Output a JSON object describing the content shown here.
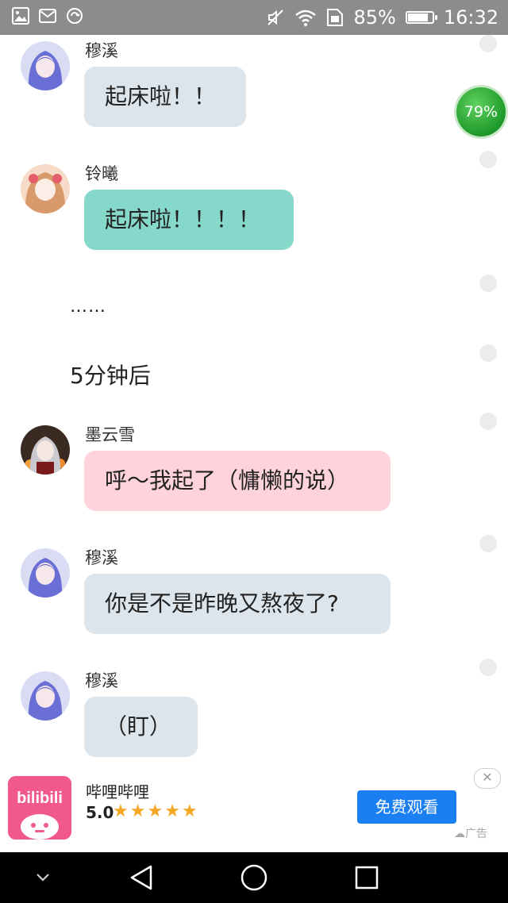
{
  "status_bar": {
    "battery_percent_text": "85%",
    "battery_level": 0.85,
    "time": "16:32",
    "left_icons": [
      "image-icon",
      "mail-icon",
      "sync-icon"
    ],
    "right_icons": [
      "mute-icon",
      "wifi-icon",
      "sim-icon",
      "battery-icon"
    ]
  },
  "floating_badge": {
    "text": "79%"
  },
  "chat": {
    "messages": [
      {
        "sender": "穆溪",
        "text": "起床啦！！",
        "bubble_color": "#dde5ec"
      },
      {
        "sender": "铃曦",
        "text": "起床啦！！！！",
        "bubble_color": "#86d8cb"
      },
      {
        "sender": "墨云雪",
        "text": "呼～我起了（慵懒的说）",
        "bubble_color": "#ffd3dc"
      },
      {
        "sender": "穆溪",
        "text": "你是不是昨晚又熬夜了?",
        "bubble_color": "#dde5ec"
      },
      {
        "sender": "穆溪",
        "text": "（盯）",
        "bubble_color": "#dde5ec"
      }
    ],
    "narration": [
      "……",
      "5分钟后"
    ]
  },
  "ad": {
    "app_name": "哔哩哔哩",
    "rating_text": "5.0",
    "rating_value": 4.5,
    "rating_max": 5,
    "button_label": "免费观看",
    "tag": "广告",
    "close_symbol": "✕",
    "logo_text": "bilibili"
  },
  "nav_bar": {
    "buttons": [
      "collapse-icon",
      "back-icon",
      "home-icon",
      "recents-icon"
    ]
  },
  "colors": {
    "status_bar": "#8c8c8c",
    "ad_button": "#1a7ff0",
    "badge_green": "#1e9a2a",
    "star": "#f5a623",
    "logo_pink": "#f0598a"
  }
}
